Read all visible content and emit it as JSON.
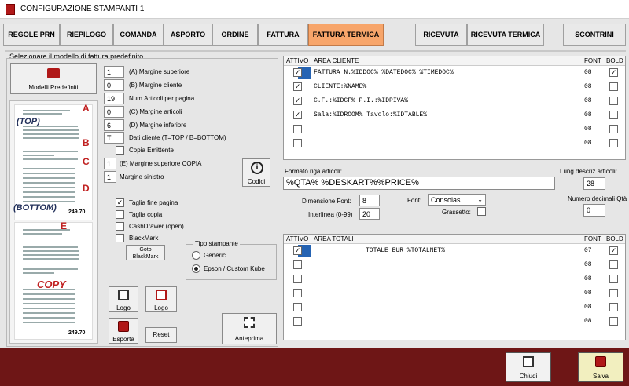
{
  "window": {
    "title": "CONFIGURAZIONE STAMPANTI 1"
  },
  "tabs": [
    {
      "label": "REGOLE PRN"
    },
    {
      "label": "RIEPILOGO"
    },
    {
      "label": "COMANDA"
    },
    {
      "label": "ASPORTO"
    },
    {
      "label": "ORDINE"
    },
    {
      "label": "FATTURA"
    },
    {
      "label": "FATTURA TERMICA"
    },
    {
      "label": "RICEVUTA"
    },
    {
      "label": "RICEVUTA TERMICA"
    },
    {
      "label": "SCONTRINI"
    }
  ],
  "left_panel": {
    "header": "Selezionare il modello di fattura predefinito",
    "models_button": "Modelli Predefiniti",
    "fields": [
      {
        "value": "1",
        "label": "(A) Margine superiore"
      },
      {
        "value": "0",
        "label": "(B) Margine cliente"
      },
      {
        "value": "19",
        "label": "Num.Articoli per pagina"
      },
      {
        "value": "0",
        "label": "(C) Margine articoli"
      },
      {
        "value": "6",
        "label": "(D) Margine inferiore"
      },
      {
        "value": "T",
        "label": "Dati cliente (T=TOP / B=BOTTOM)"
      }
    ],
    "copia_emittente": "Copia Emittente",
    "fields2": [
      {
        "value": "1",
        "label": "(E) Margine superiore COPIA"
      },
      {
        "value": "1",
        "label": "Margine sinistro"
      }
    ],
    "codici_button": "Codici",
    "checks": [
      {
        "label": "Taglia fine pagina",
        "checked": true,
        "mark": "✓"
      },
      {
        "label": "Taglia copia",
        "checked": false,
        "mark": ""
      },
      {
        "label": "CashDrawer (open)",
        "checked": false,
        "mark": ""
      },
      {
        "label": "BlackMark",
        "checked": false,
        "mark": ""
      }
    ],
    "goto_blackmark": "Goto BlackMark",
    "tipo_stampante": {
      "title": "Tipo stampante",
      "options": [
        {
          "label": "Generic",
          "selected": false
        },
        {
          "label": "Epson / Custom Kube",
          "selected": true
        }
      ]
    },
    "logo_button_1": "Logo",
    "logo_button_2": "Logo",
    "esporta_button": "Esporta",
    "reset_button": "Reset",
    "anteprima_button": "Anteprima",
    "preview": {
      "markers": [
        "A",
        "B",
        "C",
        "D",
        "E"
      ],
      "top_tag": "(TOP)",
      "bottom_tag": "(BOTTOM)",
      "copy_tag": "COPY",
      "total_1": "249.70",
      "total_2": "249.70"
    }
  },
  "area_cliente": {
    "headers": {
      "attivo": "ATTIVO",
      "area": "AREA CLIENTE",
      "font": "FONT",
      "bold": "BOLD"
    },
    "rows": [
      {
        "active": "✓",
        "text": "FATTURA N.%IDDOC% %DATEDOC% %TIMEDOC%",
        "font": "08",
        "bold": "✓",
        "selected": true
      },
      {
        "active": "✓",
        "text": "CLIENTE:%NAME%",
        "font": "08",
        "bold": "",
        "selected": false
      },
      {
        "active": "✓",
        "text": "C.F.:%IDCF% P.I.:%IDPIVA%",
        "font": "08",
        "bold": "",
        "selected": false
      },
      {
        "active": "✓",
        "text": "Sala:%IDROOM% Tavolo:%IDTABLE%",
        "font": "08",
        "bold": "",
        "selected": false
      },
      {
        "active": "",
        "text": "",
        "font": "08",
        "bold": "",
        "selected": false
      },
      {
        "active": "",
        "text": "",
        "font": "08",
        "bold": "",
        "selected": false
      }
    ]
  },
  "formato": {
    "label": "Formato riga articoli:",
    "value": "%QTA% %DESKART%%PRICE%",
    "lung_label": "Lung descriz articoli:",
    "lung_value": "28",
    "dim_font_label": "Dimensione Font:",
    "dim_font_value": "8",
    "interlinea_label": "Interlinea (0-99)",
    "interlinea_value": "20",
    "font_label": "Font:",
    "font_value": "Consolas",
    "grassetto_label": "Grassetto:",
    "decimali_label": "Numero decimali Qtà",
    "decimali_value": "0"
  },
  "area_totali": {
    "headers": {
      "attivo": "ATTIVO",
      "area": "AREA TOTALI",
      "font": "FONT",
      "bold": "BOLD"
    },
    "rows": [
      {
        "active": "✓",
        "text": "TOTALE EUR %TOTALNET%",
        "font": "07",
        "bold": "✓",
        "selected": true
      },
      {
        "active": "",
        "text": "",
        "font": "08",
        "bold": "",
        "selected": false
      },
      {
        "active": "",
        "text": "",
        "font": "08",
        "bold": "",
        "selected": false
      },
      {
        "active": "",
        "text": "",
        "font": "08",
        "bold": "",
        "selected": false
      },
      {
        "active": "",
        "text": "",
        "font": "08",
        "bold": "",
        "selected": false
      },
      {
        "active": "",
        "text": "",
        "font": "08",
        "bold": "",
        "selected": false
      }
    ]
  },
  "footer": {
    "chiudi": "Chiudi",
    "salva": "Salva"
  }
}
